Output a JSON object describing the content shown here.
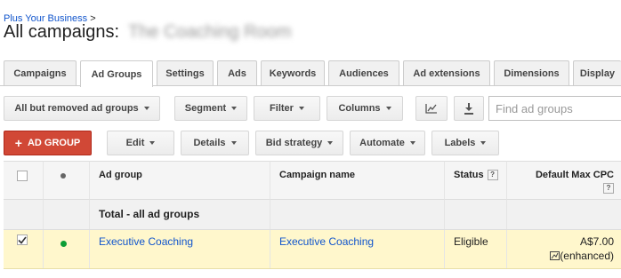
{
  "breadcrumb": {
    "parent": "Plus Your Business",
    "separator": ">"
  },
  "page": {
    "title": "All campaigns:",
    "blurred_name": "The Coaching Room"
  },
  "tabs": [
    "Campaigns",
    "Ad Groups",
    "Settings",
    "Ads",
    "Keywords",
    "Audiences",
    "Ad extensions",
    "Dimensions",
    "Display"
  ],
  "active_tab": "Ad Groups",
  "toolbar": {
    "filter_status": "All but removed ad groups",
    "segment": "Segment",
    "filter": "Filter",
    "columns": "Columns",
    "chart_icon": "line-chart-icon",
    "download_icon": "download-icon",
    "search_placeholder": "Find ad groups"
  },
  "actions": {
    "add": "AD GROUP",
    "add_icon": "plus-icon",
    "edit": "Edit",
    "details": "Details",
    "bid_strategy": "Bid strategy",
    "automate": "Automate",
    "labels": "Labels"
  },
  "table": {
    "headers": {
      "ad_group": "Ad group",
      "campaign": "Campaign name",
      "status": "Status",
      "max_cpc": "Default Max CPC",
      "help": "?"
    },
    "total_label": "Total - all ad groups",
    "rows": [
      {
        "checked": true,
        "enabled": true,
        "ad_group": "Executive Coaching",
        "campaign": "Executive Coaching",
        "status": "Eligible",
        "max_cpc": "A$7.00",
        "bid_note": "(enhanced)"
      }
    ]
  },
  "colors": {
    "accent_red": "#d14836",
    "link_blue": "#1155cc",
    "selected_row": "#fff7cc",
    "enabled_dot": "#0c9d35"
  }
}
